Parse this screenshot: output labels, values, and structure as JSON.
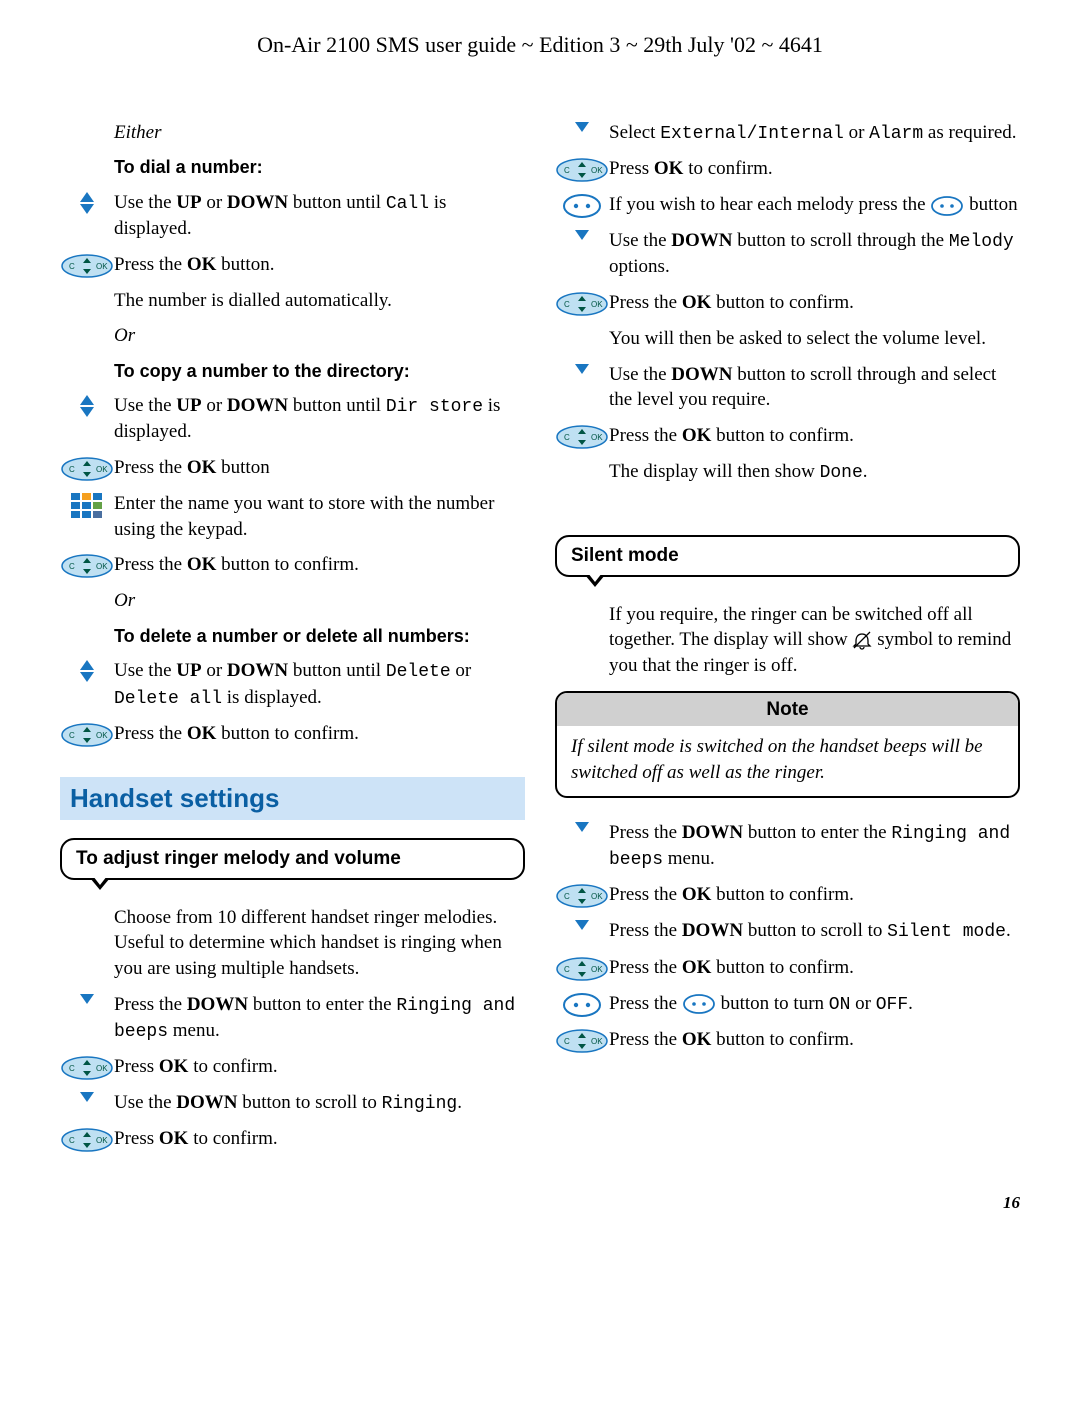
{
  "header": "On-Air 2100 SMS user guide ~ Edition 3 ~ 29th July '02 ~ 4641",
  "page_number": "16",
  "left": {
    "either": "Either",
    "dial_heading": "To dial a number:",
    "dial_1a": "Use the ",
    "dial_1b": " or ",
    "dial_1c": " button until ",
    "dial_1_mono": "Call",
    "dial_1d": " is displayed.",
    "up": "UP",
    "down": "DOWN",
    "ok": "OK",
    "dial_2a": "Press the ",
    "dial_2b": " button.",
    "dial_3": "The number is dialled automatically.",
    "or1": "Or",
    "copy_heading": "To copy a number to the directory:",
    "copy_1a": "Use the ",
    "copy_1b": " or ",
    "copy_1c": " button until ",
    "copy_1_mono": "Dir store",
    "copy_1d": " is displayed.",
    "copy_2a": "Press the ",
    "copy_2b": " button",
    "copy_3": "Enter the name you want to store with the number using the keypad.",
    "copy_4a": "Press the ",
    "copy_4b": " button to confirm.",
    "or2": "Or",
    "del_heading": "To delete a number or delete all numbers:",
    "del_1a": "Use the ",
    "del_1b": " or ",
    "del_1c": " button until ",
    "del_1_m1": "Delete",
    "del_1_or": " or ",
    "del_1_m2": "Delete all",
    "del_1d": " is displayed.",
    "del_2a": "Press the ",
    "del_2b": " button to confirm.",
    "section_handset": "Handset settings",
    "bubble_ringer": "To adjust ringer melody and volume",
    "ringer_intro": "Choose from 10 different handset ringer melodies. Useful to determine which handset is ringing when you are using multiple handsets.",
    "r1a": "Press the ",
    "r1b": " button to enter the ",
    "r1_mono": "Ringing and beeps",
    "r1c": " menu.",
    "r2a": "Press ",
    "r2b": " to confirm.",
    "r3a": "Use the ",
    "r3b": " button to scroll to ",
    "r3_mono": "Ringing",
    "r3c": ".",
    "r4a": "Press ",
    "r4b": " to confirm."
  },
  "right": {
    "s1a": "Select ",
    "s1_m1": "External/Internal",
    "s1b": " or ",
    "s1_m2": "Alarm",
    "s1c": " as required.",
    "s2a": "Press ",
    "s2b": " to confirm.",
    "s3a": "If you wish to hear each melody press the ",
    "s3b": " button",
    "s4a": "Use the ",
    "s4b": " button to scroll through the ",
    "s4_mono": "Melody",
    "s4c": " options.",
    "s5a": "Press the ",
    "s5b": " button to confirm.",
    "s6": "You will then be asked to select the volume level.",
    "s7a": "Use the ",
    "s7b": " button to scroll through and select the level you require.",
    "s8a": "Press the ",
    "s8b": " button to confirm.",
    "s9a": "The display will then show ",
    "s9_mono": "Done",
    "s9b": ".",
    "bubble_silent": "Silent mode",
    "silent_intro_a": "If you require, the ringer can be switched off all together. The display will show ",
    "silent_intro_b": " symbol to remind you that the ringer is off.",
    "note_title": "Note",
    "note_body": "If silent mode is switched on the handset beeps will be switched off as well as the ringer.",
    "t1a": "Press the ",
    "t1b": " button to enter the ",
    "t1_mono": "Ringing and beeps",
    "t1c": " menu.",
    "t2a": "Press the ",
    "t2b": " button to confirm.",
    "t3a": "Press the ",
    "t3b": " button to scroll to ",
    "t3_mono": "Silent mode",
    "t3c": ".",
    "t4a": "Press the ",
    "t4b": " button to confirm.",
    "t5a": "Press the ",
    "t5b": " button to turn ",
    "t5_m1": "ON",
    "t5_or": " or ",
    "t5_m2": "OFF",
    "t5c": ".",
    "t6a": "Press the ",
    "t6b": " button to confirm.",
    "down": "DOWN",
    "ok": "OK"
  }
}
